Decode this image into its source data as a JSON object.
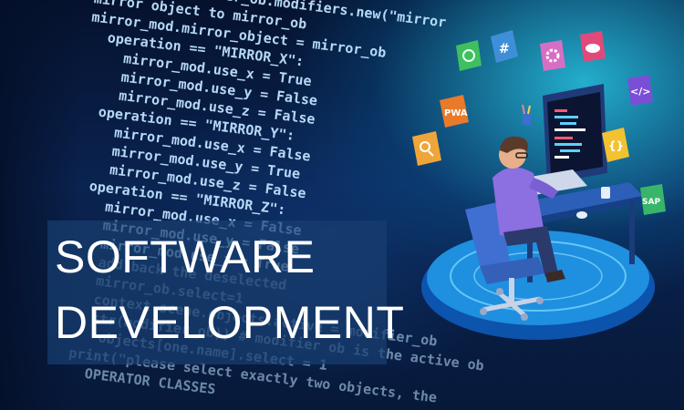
{
  "headline": {
    "line1": "SOFTWARE",
    "line2": "DEVELOPMENT"
  },
  "code_lines": [
    "irror_mod = modifier_ob.modifiers.new(\"mirror",
    "mirror object to mirror_ob",
    "mirror_mod.mirror_object = mirror_ob",
    "operation == \"MIRROR_X\":",
    "mirror_mod.use_x = True",
    "mirror_mod.use_y = False",
    "mirror_mod.use_z = False",
    "operation == \"MIRROR_Y\":",
    "mirror_mod.use_x = False",
    "mirror_mod.use_y = True",
    "mirror_mod.use_z = False",
    "operation == \"MIRROR_Z\":",
    "mirror_mod.use_x = False",
    "mirror_mod.use_y = False",
    "mirror_mod.use_z = True",
    "add back the deselected",
    "mirror_ob.select=1",
    "context.scene.objects.active = modifier_ob",
    "str(modifier_ob)) # modifier ob is the active ob",
    "objects[one.name].select = 1",
    "print(\"please select exactly two objects, the",
    "OPERATOR CLASSES"
  ],
  "app_icons": [
    {
      "label": "",
      "icon": "fingerprint-icon",
      "color": "#3fbf5f"
    },
    {
      "label": "",
      "icon": "slack-icon",
      "color": "#3f8fd8"
    },
    {
      "label": "",
      "icon": "gear-icon",
      "color": "#d66fc4"
    },
    {
      "label": "",
      "icon": "cloud-icon",
      "color": "#e04a7a"
    },
    {
      "label": "PWA",
      "icon": "pwa-icon",
      "color": "#e87a2a"
    },
    {
      "label": "</>",
      "icon": "code-icon",
      "color": "#7a4fd6"
    },
    {
      "label": "",
      "icon": "search-icon",
      "color": "#f0a53a"
    },
    {
      "label": "{}",
      "icon": "braces-icon",
      "color": "#f2c230"
    },
    {
      "label": "SAP",
      "icon": "sap-icon",
      "color": "#39b56a"
    }
  ],
  "colors": {
    "background": "#06163a",
    "glow": "#2ec8e6",
    "code_text": "#bfe3ff",
    "headline_box": "#173e70",
    "platform": "#1f7fd6"
  }
}
